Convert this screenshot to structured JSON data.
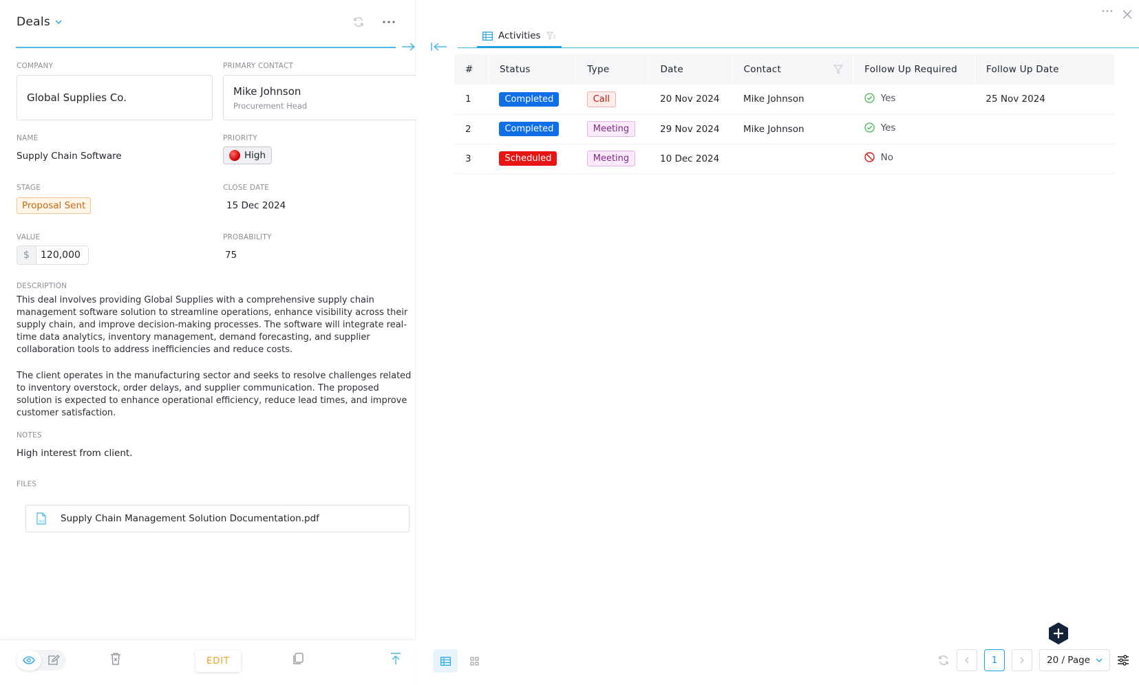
{
  "left": {
    "title": "Deals",
    "fields": {
      "company": {
        "label": "COMPANY",
        "value": "Global Supplies Co."
      },
      "primary_contact": {
        "label": "PRIMARY CONTACT",
        "name": "Mike Johnson",
        "role": "Procurement Head"
      },
      "name": {
        "label": "NAME",
        "value": "Supply Chain Software"
      },
      "priority": {
        "label": "PRIORITY",
        "value": "High"
      },
      "stage": {
        "label": "STAGE",
        "value": "Proposal Sent"
      },
      "close_date": {
        "label": "CLOSE DATE",
        "value": "15 Dec 2024"
      },
      "value": {
        "label": "VALUE",
        "currency": "$",
        "amount": "120,000"
      },
      "probability": {
        "label": "PROBABILITY",
        "value": "75"
      },
      "description": {
        "label": "DESCRIPTION",
        "p1": "This deal involves providing Global Supplies with a comprehensive supply chain management software solution to streamline operations, enhance visibility across their supply chain, and improve decision-making processes. The software will integrate real-time data analytics, inventory management, demand forecasting, and supplier collaboration tools to address inefficiencies and reduce costs.",
        "p2": "The client operates in the manufacturing sector and seeks to resolve challenges related to inventory overstock, order delays, and supplier communication. The proposed solution is expected to enhance operational efficiency, reduce lead times, and improve customer satisfaction."
      },
      "notes": {
        "label": "NOTES",
        "value": "High interest from client."
      },
      "files": {
        "label": "FILES",
        "file_name": "Supply Chain Management Solution Documentation.pdf"
      }
    },
    "footer": {
      "edit_label": "EDIT"
    }
  },
  "right": {
    "tab_label": "Activities",
    "columns": [
      "#",
      "Status",
      "Type",
      "Date",
      "Contact",
      "Follow Up Required",
      "Follow Up Date"
    ],
    "rows": [
      {
        "num": "1",
        "status": "Completed",
        "type": "Call",
        "date": "20 Nov 2024",
        "contact": "Mike Johnson",
        "follow_up": "Yes",
        "follow_up_date": "25 Nov 2024"
      },
      {
        "num": "2",
        "status": "Completed",
        "type": "Meeting",
        "date": "29 Nov 2024",
        "contact": "Mike Johnson",
        "follow_up": "Yes",
        "follow_up_date": ""
      },
      {
        "num": "3",
        "status": "Scheduled",
        "type": "Meeting",
        "date": "10 Dec 2024",
        "contact": "",
        "follow_up": "No",
        "follow_up_date": ""
      }
    ],
    "pager": {
      "current_page": "1",
      "page_size": "20 / Page"
    }
  },
  "colors": {
    "accent": "#1ba1e2",
    "completed": "#0f6fe8",
    "scheduled": "#e81515",
    "edit": "#f0a020"
  }
}
